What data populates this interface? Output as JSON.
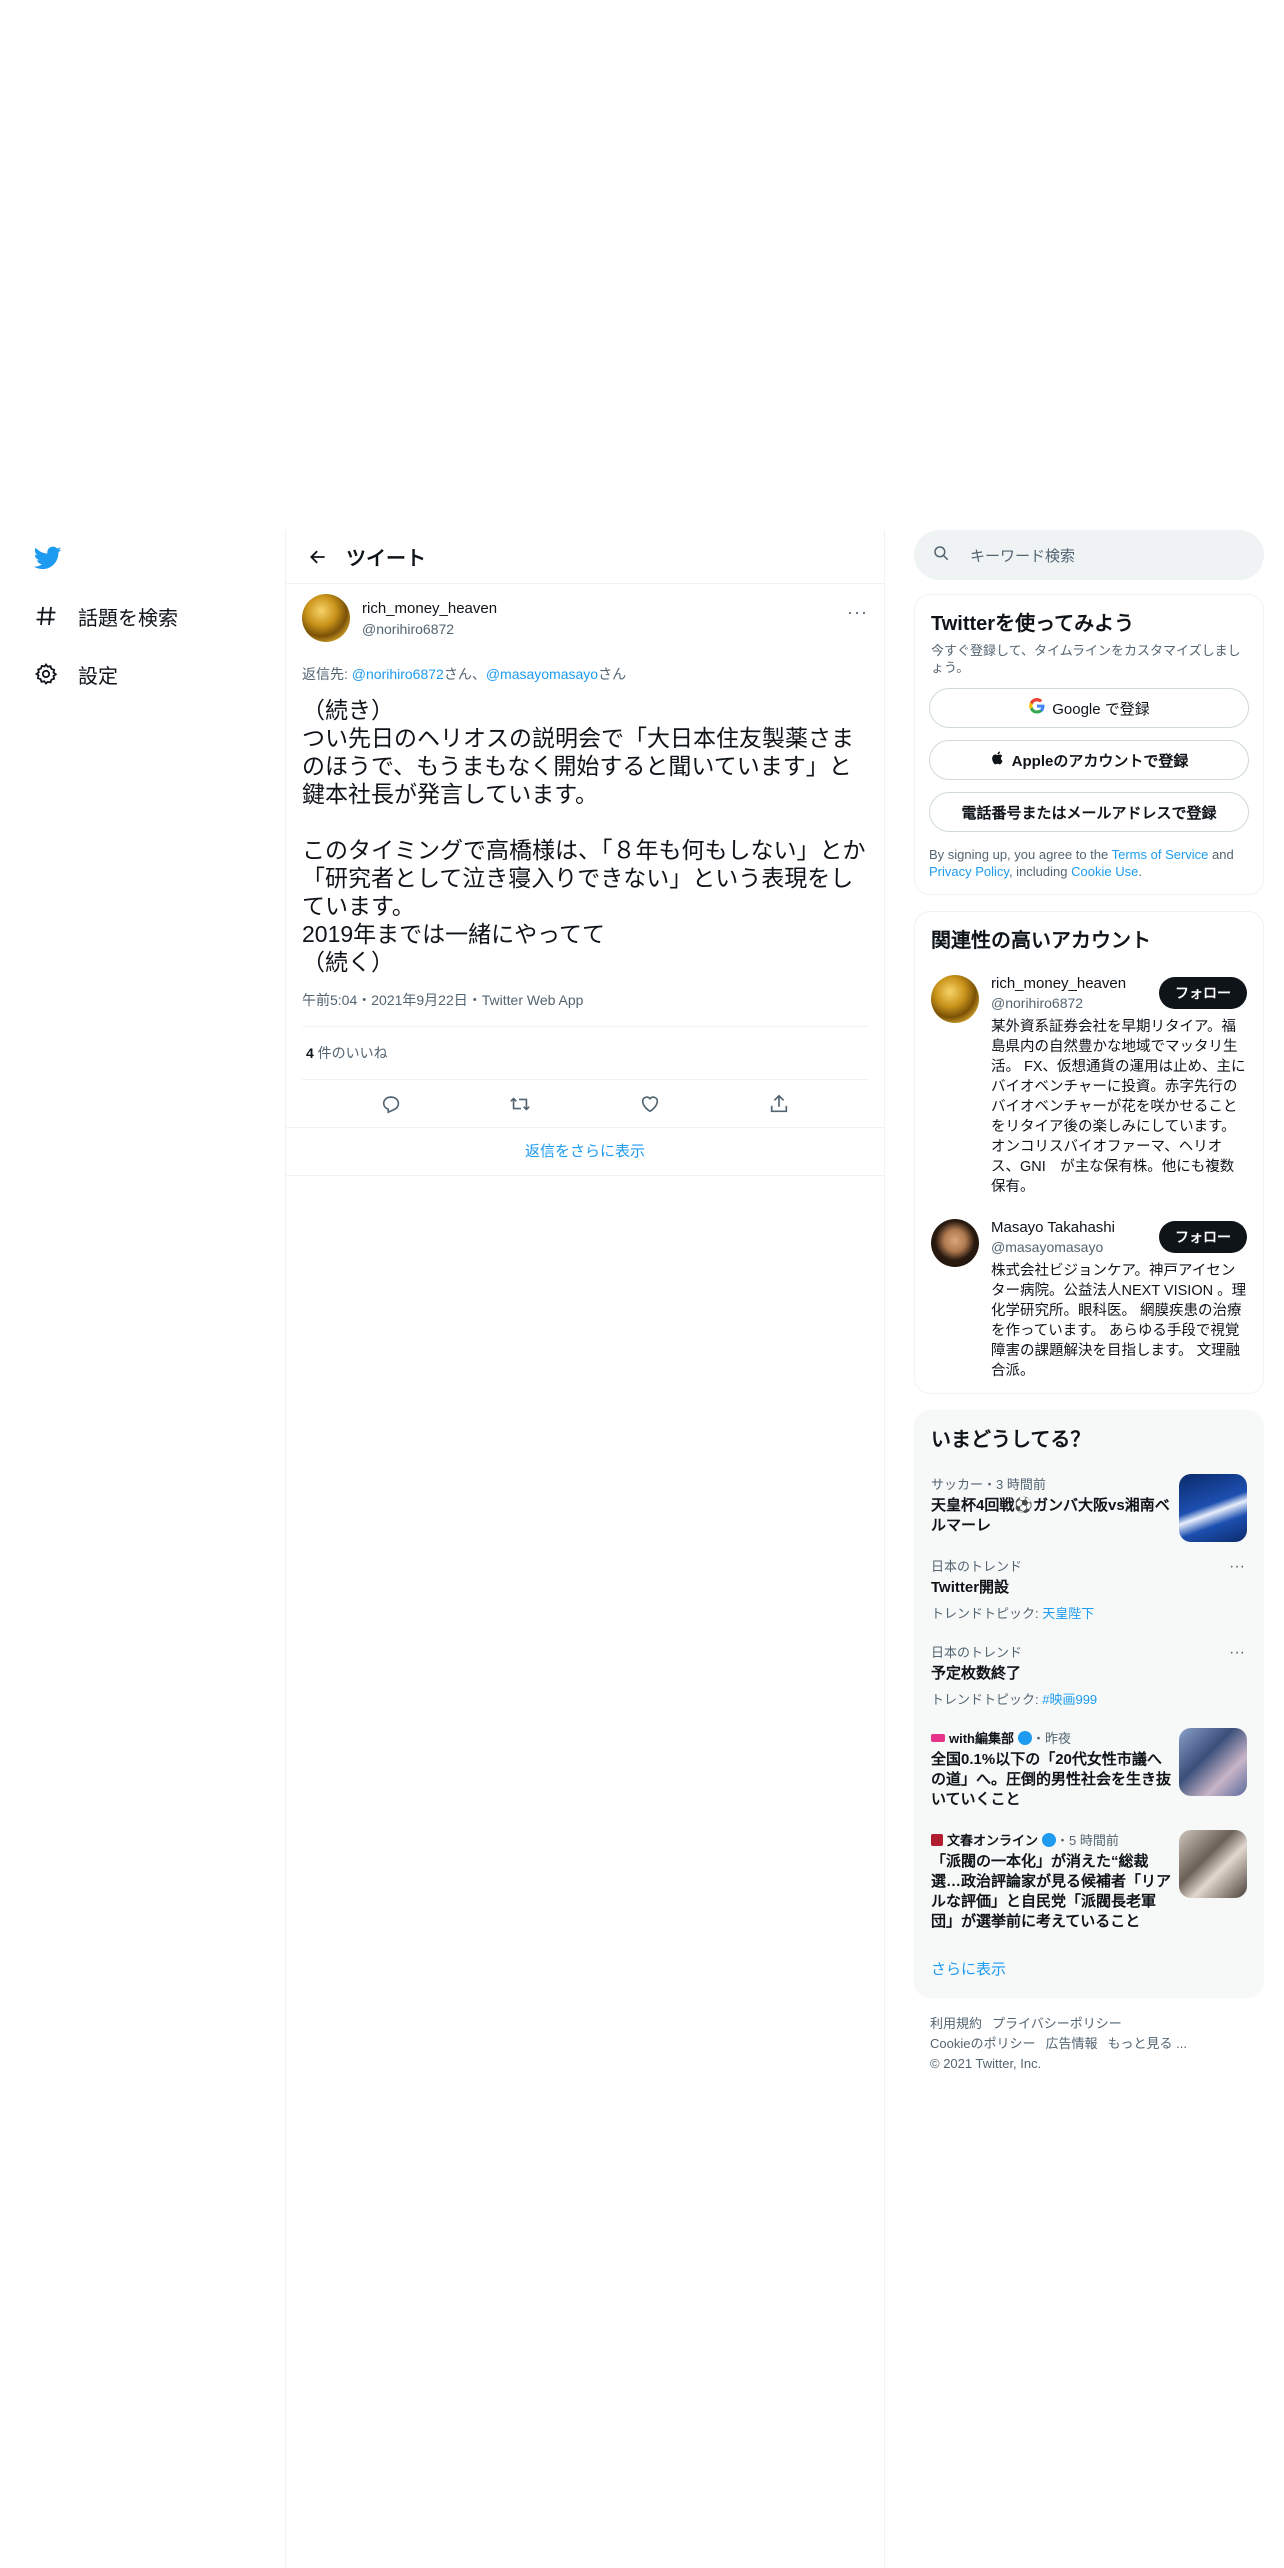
{
  "nav": {
    "logo": "twitter-bird-icon",
    "items": [
      {
        "label": "話題を検索",
        "icon": "hash-icon"
      },
      {
        "label": "設定",
        "icon": "gear-icon"
      }
    ]
  },
  "header": {
    "title": "ツイート"
  },
  "tweet": {
    "display_name": "rich_money_heaven",
    "username": "@norihiro6872",
    "more": "···",
    "reply_prefix": "返信先: ",
    "reply_user1": "@norihiro6872",
    "reply_san1": "さん、",
    "reply_user2": "@masayomasayo",
    "reply_san2": "さん",
    "body": "（続き）\nつい先日のヘリオスの説明会で「大日本住友製薬さまのほうで、もうまもなく開始すると聞いています」と鍵本社長が発言しています。\n\nこのタイミングで高橋様は、「８年も何もしない」とか「研究者として泣き寝入りできない」という表現をしています。\n2019年までは一緒にやってて\n（続く）",
    "meta": "午前5:04・2021年9月22日・Twitter Web App",
    "likes_count": "4",
    "likes_label": " 件のいいね",
    "show_more_replies": "返信をさらに表示"
  },
  "search": {
    "placeholder": "キーワード検索"
  },
  "signup": {
    "title": "Twitterを使ってみよう",
    "subtitle": "今すぐ登録して、タイムラインをカスタマイズしましょう。",
    "google": "Google で登録",
    "apple": "Appleのアカウントで登録",
    "phone": "電話番号またはメールアドレスで登録",
    "terms_pre": "By signing up, you agree to the ",
    "terms_tos": "Terms of Service",
    "terms_and": " and ",
    "terms_privacy": "Privacy Policy",
    "terms_incl": ", including ",
    "terms_cookie": "Cookie Use",
    "terms_end": "."
  },
  "related": {
    "title": "関連性の高いアカウント",
    "follow_label": "フォロー",
    "accounts": [
      {
        "name": "rich_money_heaven",
        "handle": "@norihiro6872",
        "bio": "某外資系証券会社を早期リタイア。福島県内の自然豊かな地域でマッタリ生活。 FX、仮想通貨の運用は止め、主にバイオベンチャーに投資。赤字先行のバイオベンチャーが花を咲かせることをリタイア後の楽しみにしています。 オンコリスバイオファーマ、ヘリオス、GNI　が主な保有株。他にも複数保有。"
      },
      {
        "name": "Masayo Takahashi",
        "handle": "@masayomasayo",
        "bio": "株式会社ビジョンケア。神戸アイセンター病院。公益法人NEXT VISION 。理化学研究所。眼科医。 網膜疾患の治療を作っています。 あらゆる手段で視覚障害の課題解決を目指します。 文理融合派。"
      }
    ]
  },
  "trends": {
    "title": "いまどうしてる？",
    "items": [
      {
        "context": "サッカー・3 時間前",
        "title": "天皇杯4回戦⚽ガンバ大阪vs湘南ベルマーレ"
      },
      {
        "context": "日本のトレンド",
        "title": "Twitter開設",
        "topic_label": "トレンドトピック: ",
        "topic": "天皇陛下"
      },
      {
        "context": "日本のトレンド",
        "title": "予定枚数終了",
        "topic_label": "トレンドトピック: ",
        "topic": "#映画999"
      },
      {
        "source": "with編集部",
        "time": "・昨夜",
        "title": "全国0.1%以下の「20代女性市議への道」へ。圧倒的男性社会を生き抜いていくこと"
      },
      {
        "source": "文春オンライン",
        "time": "・5 時間前",
        "title": "「派閥の一本化」が消えた“総裁選…政治評論家が見る候補者「リアルな評価」と自民党「派閥長老軍団」が選挙前に考えていること"
      }
    ],
    "show_more": "さらに表示"
  },
  "footer": {
    "links": [
      "利用規約",
      "プライバシーポリシー",
      "Cookieのポリシー",
      "広告情報",
      "もっと見る ..."
    ],
    "copyright": "© 2021 Twitter, Inc."
  },
  "colors": {
    "accent": "#1d9bf0",
    "text": "#0f1419",
    "muted": "#536471"
  }
}
